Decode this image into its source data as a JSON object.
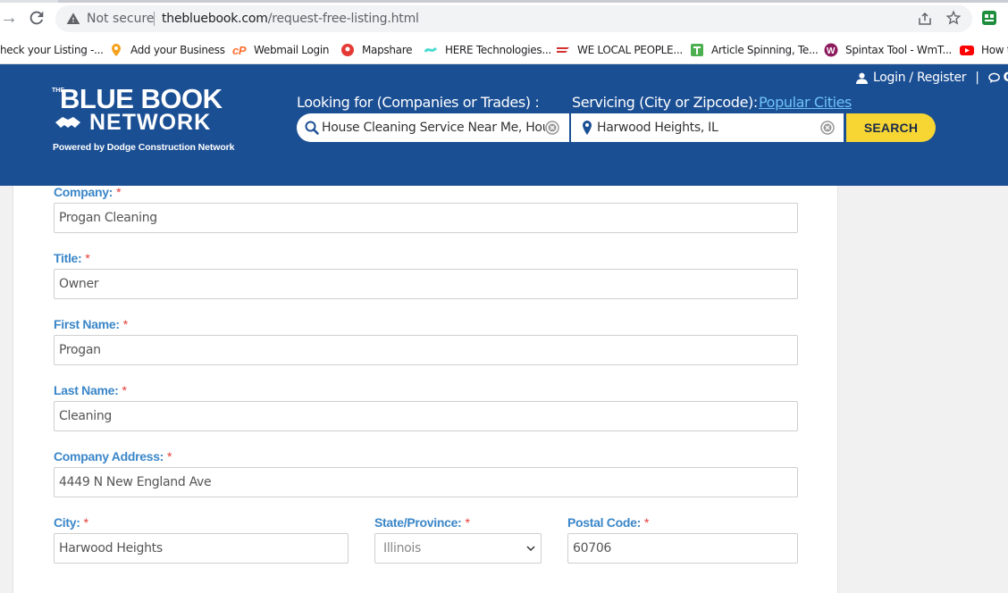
{
  "browser": {
    "security_label": "Not secure",
    "url_host": "thebluebook.com",
    "url_path": "/request-free-listing.html"
  },
  "bookmarks": [
    {
      "label": "heck your Listing -...",
      "icon": "listing-icon"
    },
    {
      "label": "Add your Business",
      "icon": "business-pin-icon",
      "color": "#f4a11d"
    },
    {
      "label": "Webmail Login",
      "icon": "cpanel-icon",
      "color": "#ff6c2c"
    },
    {
      "label": "Mapshare",
      "icon": "mapshare-icon",
      "color": "#e53935"
    },
    {
      "label": "HERE Technologies...",
      "icon": "here-icon",
      "color": "#48dad0"
    },
    {
      "label": "WE LOCAL PEOPLE...",
      "icon": "flag-icon",
      "color": "#d32f2f"
    },
    {
      "label": "Article Spinning, Te...",
      "icon": "article-icon",
      "color": "#4caf50"
    },
    {
      "label": "Spintax Tool - WmT...",
      "icon": "spintax-icon",
      "color": "#8e1b5e"
    },
    {
      "label": "How t",
      "icon": "youtube-icon",
      "color": "#ff0000"
    }
  ],
  "header": {
    "logo_the": "THE",
    "logo_line1": "BLUE BOOK",
    "logo_line2": "NETWORK",
    "logo_line3": "Powered by Dodge Construction Network",
    "login_label": "Login / Register",
    "pipe": "|",
    "chat_label": "Cl",
    "looking_label": "Looking for (Companies or Trades) :",
    "servicing_label": "Servicing (City or Zipcode):",
    "popular_label": "Popular Cities",
    "search_what_value": "House Cleaning Service Near Me, House",
    "search_where_value": "Harwood Heights, IL",
    "search_button": "SEARCH",
    "brand_color": "#1b4f94",
    "button_color": "#f7d634"
  },
  "form": {
    "company_label": "Company:",
    "company_value": "Progan Cleaning",
    "title_label": "Title:",
    "title_value": "Owner",
    "first_name_label": "First Name:",
    "first_name_value": "Progan",
    "last_name_label": "Last Name:",
    "last_name_value": "Cleaning",
    "address_label": "Company Address:",
    "address_value": "4449 N New England Ave",
    "city_label": "City:",
    "city_value": "Harwood Heights",
    "state_label": "State/Province:",
    "state_value": "Illinois",
    "postal_label": "Postal Code:",
    "postal_value": "60706",
    "required_mark": "*"
  }
}
